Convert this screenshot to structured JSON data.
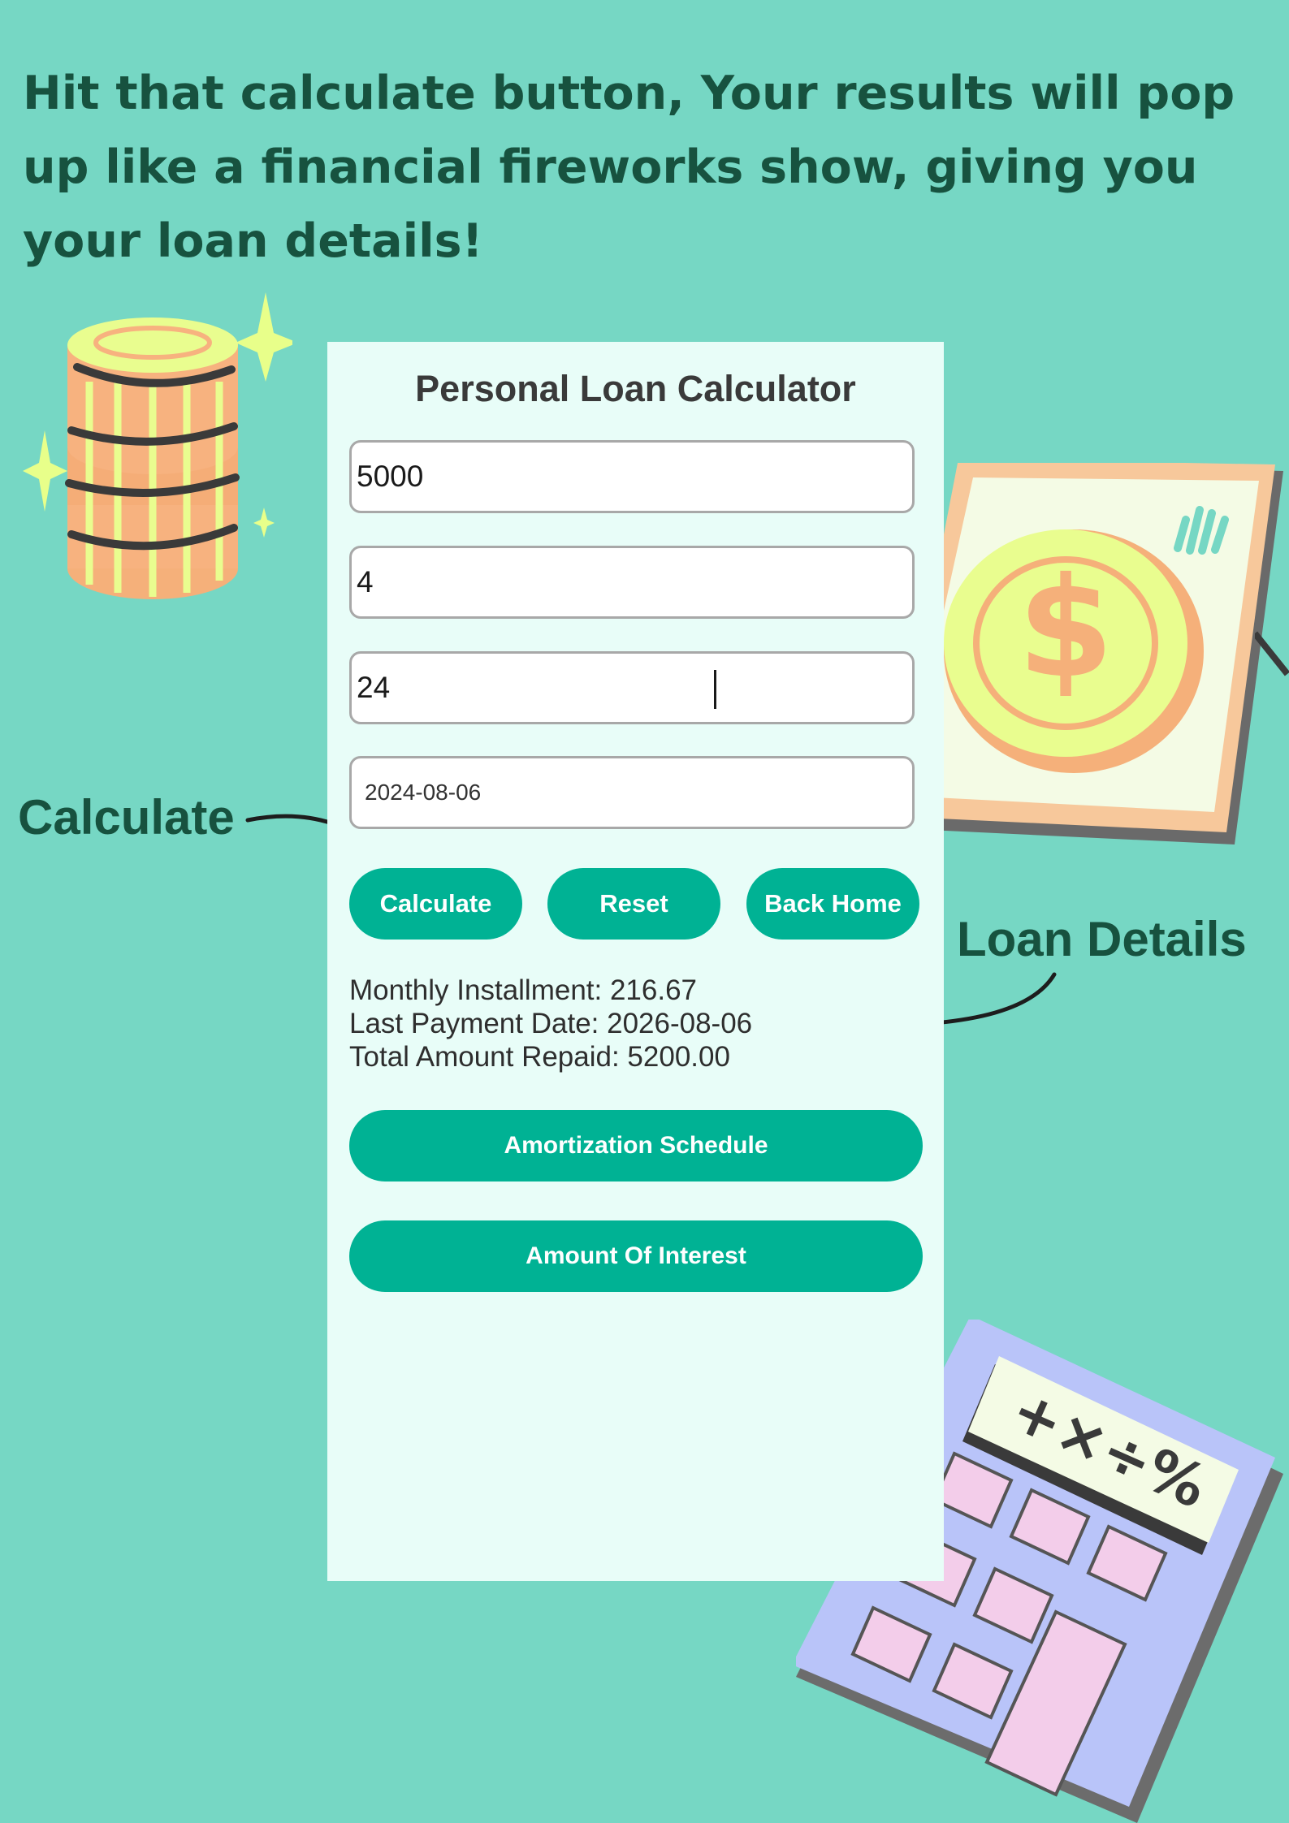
{
  "headline": "Hit that calculate button, Your results will pop up like a financial fireworks show, giving you your loan details!",
  "annotations": {
    "calculate": "Calculate",
    "loan_details": "Loan Details"
  },
  "app": {
    "title": "Personal Loan Calculator",
    "fields": {
      "amount": "5000",
      "interest": "4",
      "months": "24",
      "start_date": "2024-08-06"
    },
    "buttons": {
      "calculate": "Calculate",
      "reset": "Reset",
      "back_home": "Back Home",
      "amortization": "Amortization Schedule",
      "interest_amount": "Amount Of Interest"
    },
    "results": {
      "monthly_installment": "Monthly Installment: 216.67",
      "last_payment_date": "Last Payment Date: 2026-08-06",
      "total_repaid": "Total Amount Repaid: 5200.00"
    }
  },
  "colors": {
    "background": "#76d7c4",
    "accent": "#00b294",
    "panel": "#e8fdf8",
    "text_dark": "#17523f"
  },
  "icons": [
    "coin-stack-icon",
    "sparkle-icon",
    "dollar-card-icon",
    "calculator-icon",
    "arrow-icon"
  ]
}
